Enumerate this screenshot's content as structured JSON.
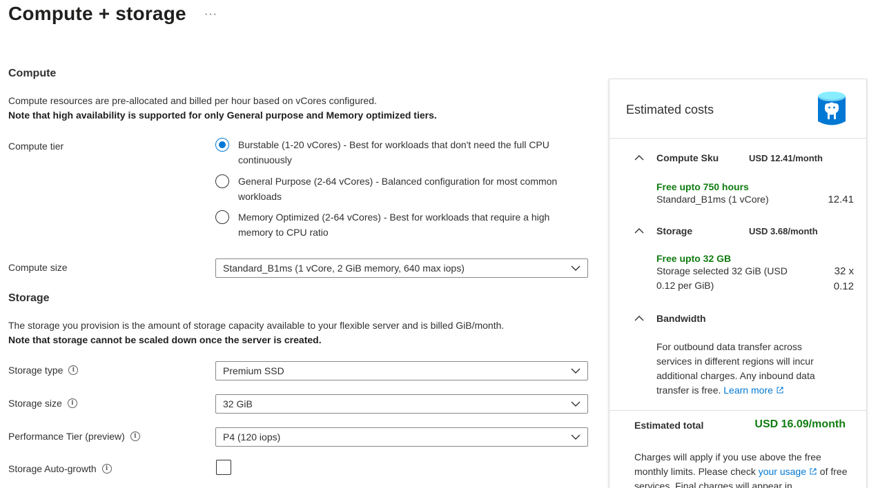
{
  "page": {
    "title": "Compute + storage",
    "more": "···"
  },
  "compute": {
    "heading": "Compute",
    "description": "Compute resources are pre-allocated and billed per hour based on vCores configured.",
    "note": "Note that high availability is supported for only General purpose and Memory optimized tiers.",
    "tier_label": "Compute tier",
    "tiers": [
      {
        "label": "Burstable (1-20 vCores) - Best for workloads that don't need the full CPU continuously",
        "selected": true
      },
      {
        "label": "General Purpose (2-64 vCores) - Balanced configuration for most common workloads",
        "selected": false
      },
      {
        "label": "Memory Optimized (2-64 vCores) - Best for workloads that require a high memory to CPU ratio",
        "selected": false
      }
    ],
    "size_label": "Compute size",
    "size_value": "Standard_B1ms (1 vCore, 2 GiB memory, 640 max iops)"
  },
  "storage": {
    "heading": "Storage",
    "description": "The storage you provision is the amount of storage capacity available to your flexible server and is billed GiB/month.",
    "note": "Note that storage cannot be scaled down once the server is created.",
    "type_label": "Storage type",
    "type_value": "Premium SSD",
    "size_label": "Storage size",
    "size_value": "32 GiB",
    "perf_label": "Performance Tier (preview)",
    "perf_value": "P4 (120 iops)",
    "autogrow_label": "Storage Auto-growth",
    "autogrow_checked": false
  },
  "costs": {
    "title": "Estimated costs",
    "compute_sku": {
      "name": "Compute Sku",
      "price": "USD 12.41/month",
      "free": "Free upto 750 hours",
      "detail": "Standard_B1ms (1 vCore)",
      "amount": "12.41"
    },
    "storage": {
      "name": "Storage",
      "price": "USD 3.68/month",
      "free": "Free upto 32 GB",
      "detail": "Storage selected 32 GiB (USD 0.12 per GiB)",
      "amount_a": "32 x",
      "amount_b": "0.12"
    },
    "bandwidth": {
      "name": "Bandwidth",
      "text": "For outbound data transfer across services in different regions will incur additional charges. Any inbound data transfer is free.",
      "link": "Learn more"
    },
    "total_label": "Estimated total",
    "total_value": "USD 16.09/month",
    "footnote_a": "Charges will apply if you use above the free monthly limits. Please check",
    "footnote_link": "your usage",
    "footnote_b": "of free services. Final charges will appear in"
  },
  "colors": {
    "accent": "#0078d4",
    "green": "#107c10",
    "text": "#323130"
  }
}
